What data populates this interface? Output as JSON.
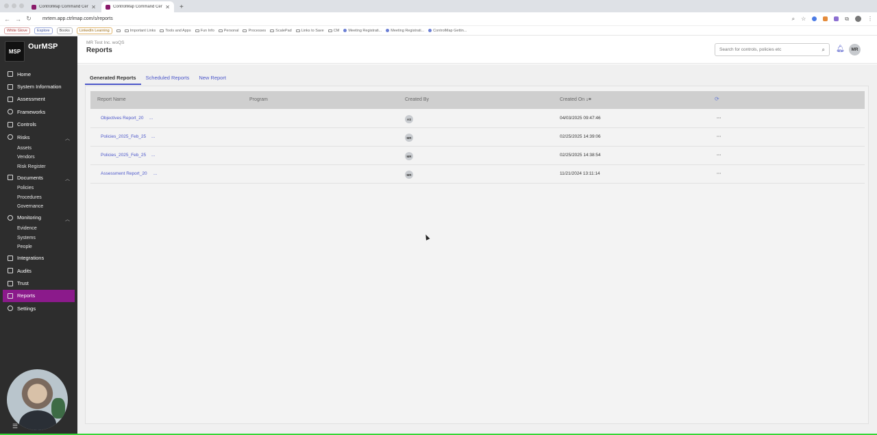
{
  "browser": {
    "tabs": [
      {
        "label": "ControlMap Command Cent...",
        "active": false
      },
      {
        "label": "ControlMap Command Cent...",
        "active": true
      }
    ],
    "url": "mrtem.app.ctrlmap.com/s/reports",
    "bookmarks_pills": [
      "White Glove",
      "Explore",
      "Books",
      "LinkedIn Learning"
    ],
    "bookmarks_folders": [
      "Important Links",
      "Tools and Apps",
      "Fun Info",
      "Personal",
      "Processes",
      "ScalePad",
      "Links to Save",
      "CM"
    ],
    "bookmarks_links": [
      "Meeting Registrati...",
      "Meeting Registrati...",
      "ControlMap Gettin..."
    ]
  },
  "sidebar": {
    "brand": "OurMSP",
    "logo_text": "MSP",
    "items": [
      {
        "label": "Home"
      },
      {
        "label": "System Information"
      },
      {
        "label": "Assessment"
      },
      {
        "label": "Frameworks"
      },
      {
        "label": "Controls"
      },
      {
        "label": "Risks",
        "children": [
          "Assets",
          "Vendors",
          "Risk Register"
        ]
      },
      {
        "label": "Documents",
        "children": [
          "Policies",
          "Procedures",
          "Governance"
        ]
      },
      {
        "label": "Monitoring",
        "children": [
          "Evidence",
          "Systems",
          "People"
        ]
      },
      {
        "label": "Integrations"
      },
      {
        "label": "Audits"
      },
      {
        "label": "Trust"
      },
      {
        "label": "Reports",
        "active": true
      },
      {
        "label": "Settings"
      }
    ]
  },
  "header": {
    "org": "MR Test Inc. woQS",
    "title": "Reports",
    "search_placeholder": "Search for controls, policies etc",
    "user_initials": "MR"
  },
  "reports": {
    "tabs": [
      "Generated Reports",
      "Scheduled Reports",
      "New Report"
    ],
    "columns": [
      "Report Name",
      "Program",
      "Created By",
      "Created On"
    ],
    "rows": [
      {
        "name": "Objectives Report_20",
        "ellipsis": "...",
        "program": "",
        "created_by": "AS",
        "created_on": "04/03/2025 09:47:46",
        "more": "···"
      },
      {
        "name": "Policies_2025_Feb_25",
        "ellipsis": "...",
        "program": "",
        "created_by": "MR",
        "created_on": "02/25/2025 14:39:06",
        "more": "···"
      },
      {
        "name": "Policies_2025_Feb_25",
        "ellipsis": "...",
        "program": "",
        "created_by": "MR",
        "created_on": "02/25/2025 14:38:54",
        "more": "···"
      },
      {
        "name": "Assessment Report_20",
        "ellipsis": "...",
        "program": "",
        "created_by": "MR",
        "created_on": "11/21/2024 13:11:14",
        "more": "···"
      }
    ]
  },
  "colors": {
    "accent": "#4b56c9",
    "active_nav": "#8b1a8b",
    "sidebar_bg": "#2d2d2d"
  }
}
